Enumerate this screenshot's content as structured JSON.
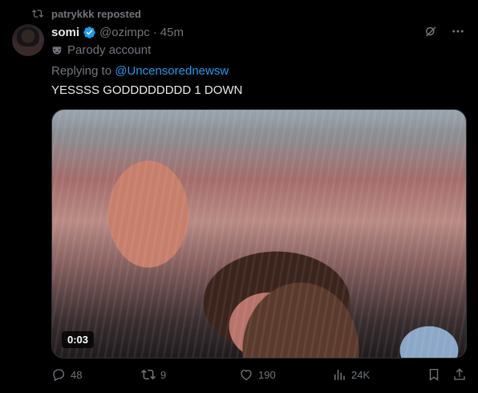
{
  "repost": {
    "text": "patrykkk reposted",
    "icon": "repost-icon"
  },
  "author": {
    "name": "somi",
    "handle": "@ozimpc",
    "separator": "·",
    "time": "45m",
    "verified_color": "#1d9bf0"
  },
  "label": {
    "text": "Parody account",
    "icon": "mask-icon"
  },
  "reply": {
    "prefix": "Replying to ",
    "mention": "@Uncensorednewsw"
  },
  "tweet": {
    "text": "YESSSS GODDDDDDDD 1 DOWN"
  },
  "media": {
    "duration": "0:03"
  },
  "stats": {
    "replies": "48",
    "reposts": "9",
    "likes": "190",
    "views": "24K"
  },
  "colors": {
    "accent": "#1d9bf0",
    "muted": "#71767b",
    "text": "#e7e9ea",
    "background": "#000000"
  }
}
